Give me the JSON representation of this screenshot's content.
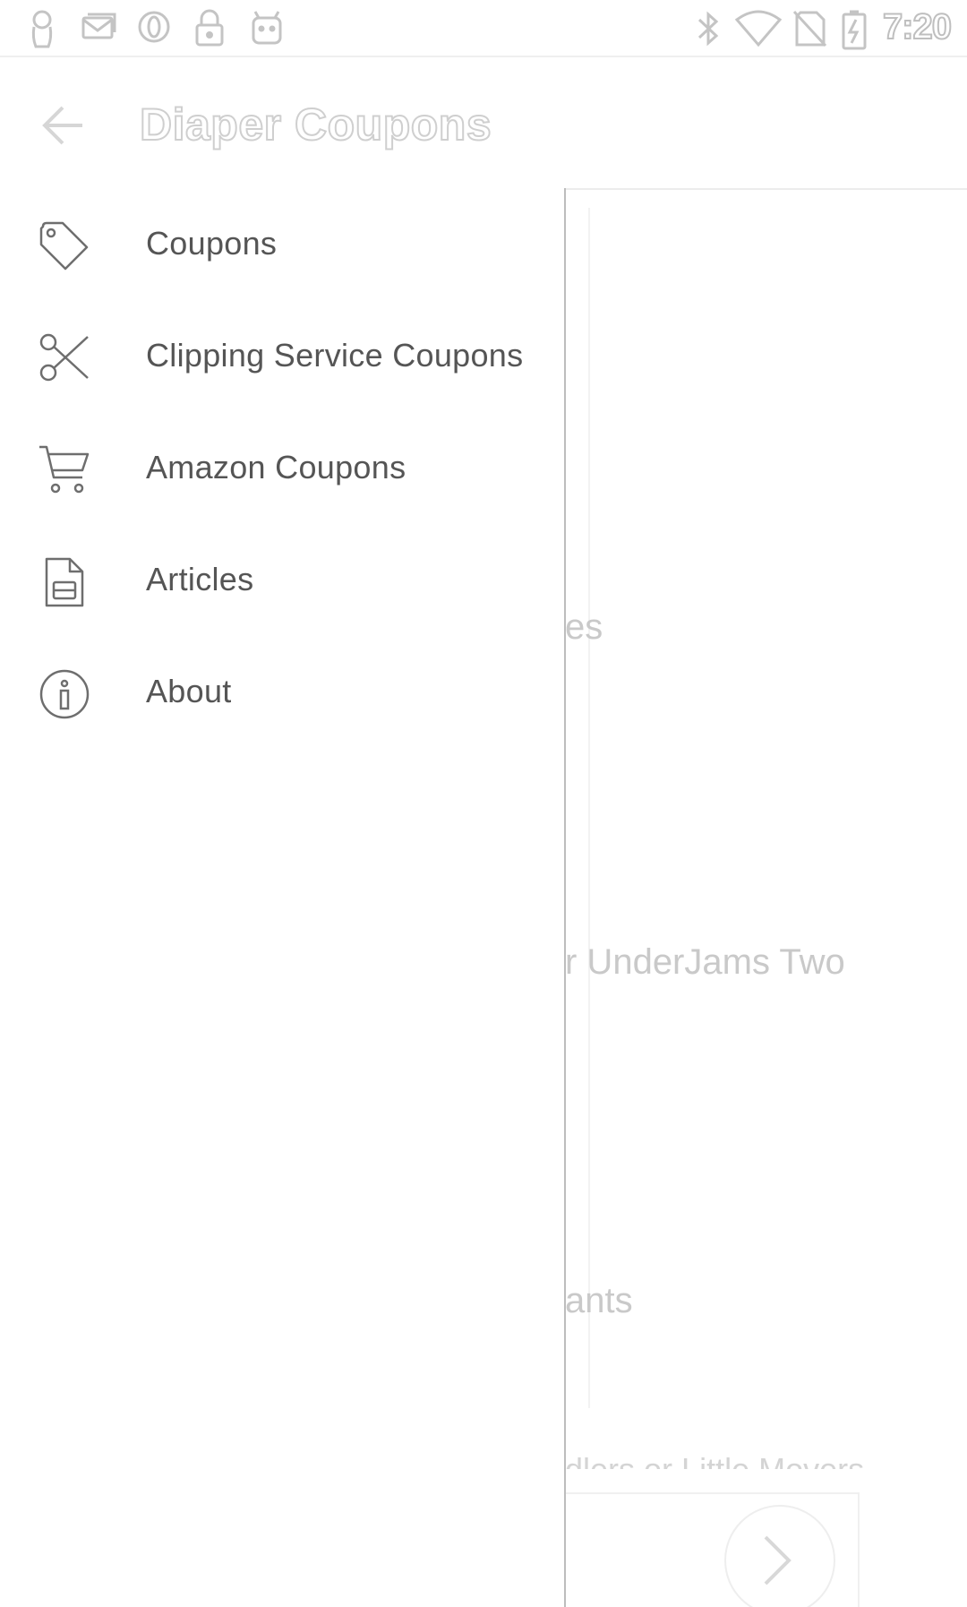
{
  "status_bar": {
    "time": "7:20",
    "left_icons": [
      "person-icon",
      "mail-icon",
      "opera-icon",
      "lock-icon",
      "android-icon"
    ],
    "right_icons": [
      "bluetooth-icon",
      "wifi-icon",
      "no-sim-icon",
      "battery-charging-icon"
    ]
  },
  "app_bar": {
    "title": "Diaper Coupons",
    "back_icon": "arrow-back-icon"
  },
  "drawer": {
    "items": [
      {
        "label": "Coupons",
        "icon": "tag-icon"
      },
      {
        "label": "Clipping Service Coupons",
        "icon": "scissors-icon"
      },
      {
        "label": "Amazon Coupons",
        "icon": "cart-icon"
      },
      {
        "label": "Articles",
        "icon": "document-icon"
      },
      {
        "label": "About",
        "icon": "info-icon"
      }
    ]
  },
  "background_content": {
    "peek_1": "es",
    "peek_2": "r UnderJams Two",
    "peek_3": "ants",
    "peek_4": "dlers or Little Movers",
    "next_icon": "chevron-right-icon"
  },
  "colors": {
    "drawer_text": "#555555",
    "icon_stroke": "#6e6e6e",
    "faded_text": "#c9c9c9",
    "drawer_border": "#bdbdbd"
  }
}
